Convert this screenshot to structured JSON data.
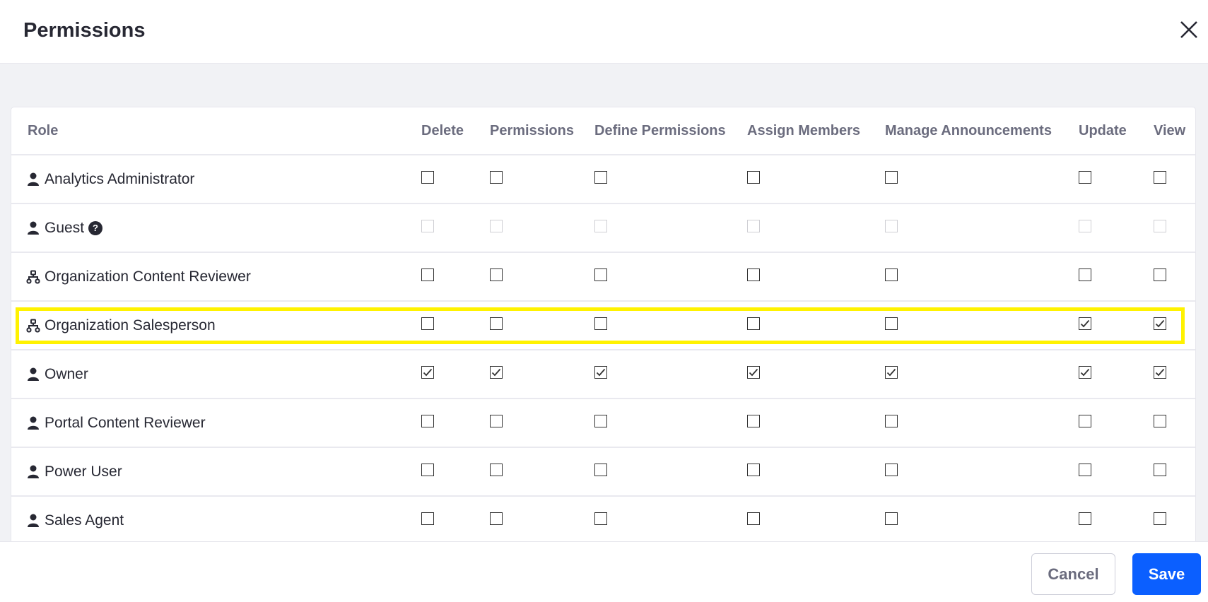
{
  "modal": {
    "title": "Permissions",
    "close_icon": "close-icon"
  },
  "table": {
    "columns": [
      "Role",
      "Delete",
      "Permissions",
      "Define Permissions",
      "Assign Members",
      "Manage Announcements",
      "Update",
      "View"
    ],
    "rows": [
      {
        "role": "Analytics Administrator",
        "icon": "user-icon",
        "help": false,
        "disabled": false,
        "checked": [
          false,
          false,
          false,
          false,
          false,
          false,
          false
        ]
      },
      {
        "role": "Guest",
        "icon": "user-icon",
        "help": true,
        "disabled": true,
        "checked": [
          false,
          false,
          false,
          false,
          false,
          false,
          false
        ]
      },
      {
        "role": "Organization Content Reviewer",
        "icon": "organization-icon",
        "help": false,
        "disabled": false,
        "checked": [
          false,
          false,
          false,
          false,
          false,
          false,
          false
        ]
      },
      {
        "role": "Organization Salesperson",
        "icon": "organization-icon",
        "help": false,
        "disabled": false,
        "highlighted": true,
        "checked": [
          false,
          false,
          false,
          false,
          false,
          true,
          true
        ]
      },
      {
        "role": "Owner",
        "icon": "user-icon",
        "help": false,
        "disabled": false,
        "checked": [
          true,
          true,
          true,
          true,
          true,
          true,
          true
        ]
      },
      {
        "role": "Portal Content Reviewer",
        "icon": "user-icon",
        "help": false,
        "disabled": false,
        "checked": [
          false,
          false,
          false,
          false,
          false,
          false,
          false
        ]
      },
      {
        "role": "Power User",
        "icon": "user-icon",
        "help": false,
        "disabled": false,
        "checked": [
          false,
          false,
          false,
          false,
          false,
          false,
          false
        ]
      },
      {
        "role": "Sales Agent",
        "icon": "user-icon",
        "help": false,
        "disabled": false,
        "checked": [
          false,
          false,
          false,
          false,
          false,
          false,
          false
        ]
      }
    ],
    "help_glyph": "?"
  },
  "footer": {
    "cancel_label": "Cancel",
    "save_label": "Save"
  },
  "colors": {
    "primary": "#0b5fff",
    "highlight": "#fff200",
    "body_bg": "#f1f2f5"
  }
}
